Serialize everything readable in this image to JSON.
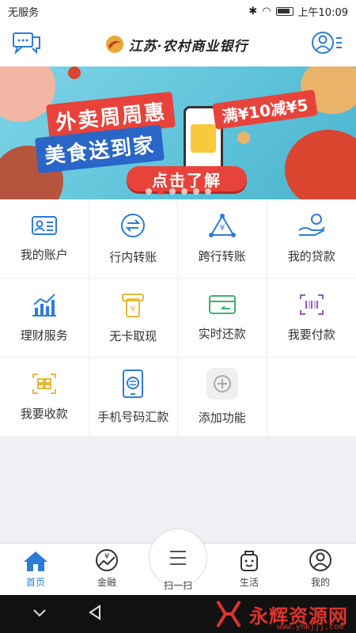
{
  "status": {
    "carrier": "无服务",
    "time": "上午10:09"
  },
  "header": {
    "brand": "江苏·农村商业银行"
  },
  "banner": {
    "line1": "外卖周周惠",
    "line2": "美食送到家",
    "promo": "满¥10减¥5",
    "cta": "点击了解",
    "active_dot": 1,
    "dot_count": 6
  },
  "grid": [
    {
      "label": "我的账户",
      "icon": "id-card-icon",
      "color": "#2f7bd6"
    },
    {
      "label": "行内转账",
      "icon": "transfer-icon",
      "color": "#2f7bd6"
    },
    {
      "label": "跨行转账",
      "icon": "cross-bank-icon",
      "color": "#2f7bd6"
    },
    {
      "label": "我的贷款",
      "icon": "loan-hand-icon",
      "color": "#2f7bd6"
    },
    {
      "label": "理财服务",
      "icon": "chart-icon",
      "color": "#2f7bd6"
    },
    {
      "label": "无卡取现",
      "icon": "cardless-icon",
      "color": "#e8b93a"
    },
    {
      "label": "实时还款",
      "icon": "repay-icon",
      "color": "#3cb371"
    },
    {
      "label": "我要付款",
      "icon": "pay-qr-icon",
      "color": "#9b59b6"
    },
    {
      "label": "我要收款",
      "icon": "receive-qr-icon",
      "color": "#e8b93a"
    },
    {
      "label": "手机号码汇款",
      "icon": "phone-remit-icon",
      "color": "#2f7bd6"
    },
    {
      "label": "添加功能",
      "icon": "add-icon",
      "color": "#aaaaaa"
    }
  ],
  "tabs": [
    {
      "label": "首页",
      "icon": "home-icon",
      "active": true
    },
    {
      "label": "金融",
      "icon": "finance-icon",
      "active": false
    },
    {
      "label": "扫一扫",
      "icon": "scan-icon",
      "active": false
    },
    {
      "label": "生活",
      "icon": "life-icon",
      "active": false
    },
    {
      "label": "我的",
      "icon": "profile-icon",
      "active": false
    }
  ],
  "watermark": {
    "text": "永辉资源网",
    "url": "www.yhkjjj.com"
  },
  "colors": {
    "accent": "#2f7bd6",
    "promo_red": "#e8433b"
  }
}
